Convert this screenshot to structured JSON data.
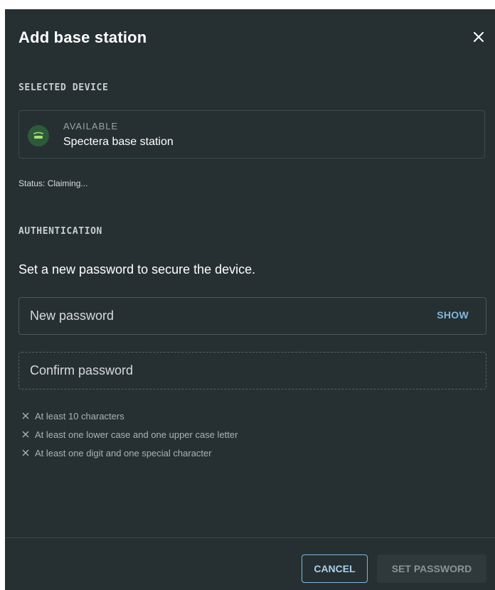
{
  "dialog": {
    "title": "Add base station",
    "close_icon": "close-icon"
  },
  "selected_device": {
    "section_label": "SELECTED DEVICE",
    "icon": "base-station-icon",
    "availability": "AVAILABLE",
    "name": "Spectera base station",
    "status": "Status: Claiming..."
  },
  "authentication": {
    "section_label": "AUTHENTICATION",
    "instruction": "Set a new password to secure the device.",
    "new_password": {
      "placeholder": "New password",
      "value": "",
      "show_label": "SHOW"
    },
    "confirm_password": {
      "placeholder": "Confirm password",
      "value": ""
    },
    "rules": [
      {
        "text": "At least 10 characters",
        "icon": "cross-icon"
      },
      {
        "text": "At least one lower case and one upper case letter",
        "icon": "cross-icon"
      },
      {
        "text": "At least one digit and one special character",
        "icon": "cross-icon"
      }
    ]
  },
  "footer": {
    "cancel_label": "CANCEL",
    "set_password_label": "SET PASSWORD"
  },
  "colors": {
    "dialog_bg": "#263032",
    "accent": "#7fb7e0",
    "device_icon_bg": "#2f5a3a",
    "device_icon_fg": "#a8e07a"
  }
}
